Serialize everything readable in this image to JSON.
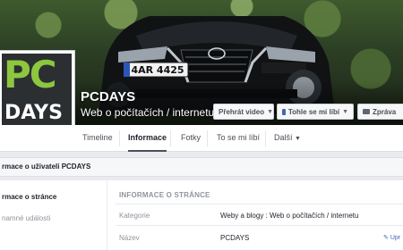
{
  "header": {
    "page_name": "PCDAYS",
    "page_category": "Web o počítačích / internetu",
    "license_plate": "4AR 4425"
  },
  "actions": {
    "video_label": "Přehrát video",
    "like_label": "Tohle se mi líbí",
    "message_label": "Zpráva"
  },
  "logo": {
    "line1": "PC",
    "line2": "DAYS"
  },
  "nav": {
    "tabs": [
      {
        "label": "Timeline"
      },
      {
        "label": "Informace"
      },
      {
        "label": "Fotky"
      },
      {
        "label": "To se mi líbí"
      },
      {
        "label": "Další"
      }
    ]
  },
  "about": {
    "header": "rmace o uživateli PCDAYS",
    "sidebar": [
      {
        "label": "rmace o stránce"
      },
      {
        "label": "namné události"
      }
    ],
    "section_title": "INFORMACE O STRÁNCE",
    "rows": [
      {
        "label": "Kategorie",
        "value": "Weby a blogy : Web o počítačích / internetu"
      },
      {
        "label": "Název",
        "value": "PCDAYS"
      }
    ],
    "edit_link": "Upr"
  },
  "colors": {
    "accent": "#4267b2",
    "logo_green": "#8dc63f",
    "logo_bg": "#2b2f31"
  }
}
